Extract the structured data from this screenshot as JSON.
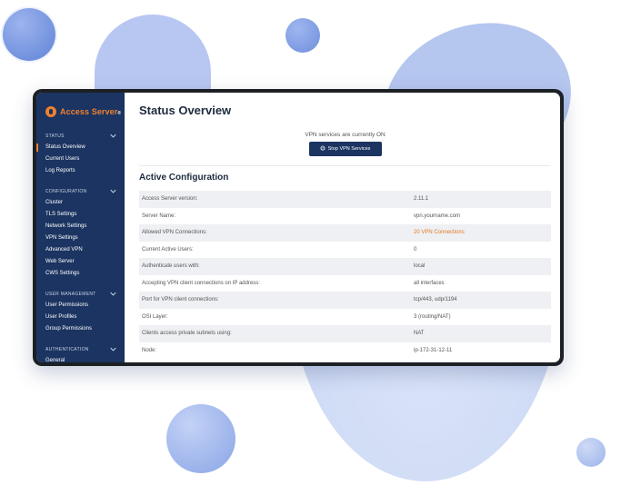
{
  "app": {
    "logo_text_accent": "Access Server",
    "logo_symbol": "®"
  },
  "sidebar": {
    "sections": [
      {
        "title": "STATUS",
        "items": [
          "Status Overview",
          "Current Users",
          "Log Reports"
        ]
      },
      {
        "title": "CONFIGURATION",
        "items": [
          "Cluster",
          "TLS Settings",
          "Network Settings",
          "VPN Settings",
          "Advanced VPN",
          "Web Server",
          "CWS Settings"
        ]
      },
      {
        "title": "USER MANAGEMENT",
        "items": [
          "User Permissions",
          "User Profiles",
          "Group Permissions"
        ]
      },
      {
        "title": "AUTHENTICATION",
        "items": [
          "General"
        ]
      }
    ],
    "active_item": "Status Overview"
  },
  "main": {
    "title": "Status Overview",
    "status_message": "VPN services are currently ON",
    "stop_button_label": "Stop VPN Services",
    "config_title": "Active Configuration",
    "rows": [
      {
        "key": "Access Server version:",
        "value": "2.11.1"
      },
      {
        "key": "Server Name:",
        "value": "vpn.yourname.com"
      },
      {
        "key": "Allowed VPN Connections:",
        "value": "20 VPN Connections",
        "highlight": true
      },
      {
        "key": "Current Active Users:",
        "value": "0"
      },
      {
        "key": "Authenticate users with:",
        "value": "local"
      },
      {
        "key": "Accepting VPN client connections on IP address:",
        "value": "all interfaces"
      },
      {
        "key": "Port for VPN client connections:",
        "value": "tcp/443, udp/1194"
      },
      {
        "key": "OSI Layer:",
        "value": "3 (routing/NAT)"
      },
      {
        "key": "Clients access private subnets using:",
        "value": "NAT"
      },
      {
        "key": "Node:",
        "value": "ip-172-31-12-11"
      }
    ]
  },
  "colors": {
    "sidebar_bg": "#1b3461",
    "accent": "#f0812e",
    "button_bg": "#1b3461",
    "highlight_text": "#e37b20"
  },
  "icons": {
    "logo": "openvpn-logo-icon",
    "section_toggle": "chevron-down-icon",
    "power": "power-icon"
  }
}
